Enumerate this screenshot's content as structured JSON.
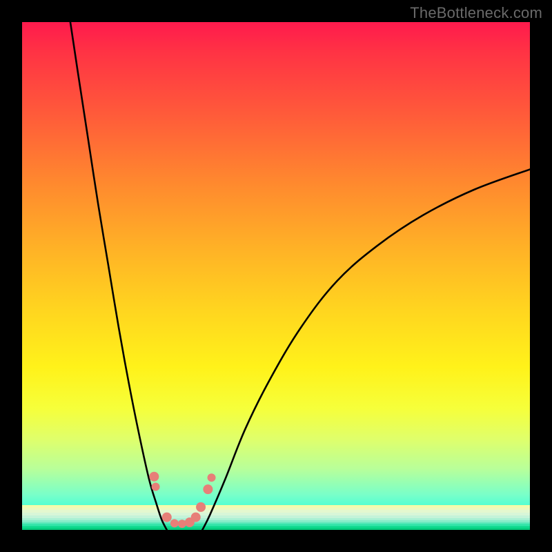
{
  "watermark": "TheBottleneck.com",
  "chart_data": {
    "type": "line",
    "title": "",
    "xlabel": "",
    "ylabel": "",
    "xlim": [
      0,
      100
    ],
    "ylim": [
      0,
      100
    ],
    "series": [
      {
        "name": "left-branch",
        "x": [
          9.5,
          11,
          13,
          15,
          17,
          19,
          21,
          23,
          25,
          26.5,
          27.5,
          28.5
        ],
        "y": [
          100,
          90,
          77,
          64,
          52,
          40,
          29,
          19,
          10,
          5,
          2,
          0
        ]
      },
      {
        "name": "right-branch",
        "x": [
          35.5,
          37,
          40,
          44,
          49,
          55,
          62,
          70,
          79,
          89,
          100
        ],
        "y": [
          0,
          3,
          10,
          20,
          30,
          40,
          49,
          56,
          62,
          67,
          71
        ]
      }
    ],
    "markers": {
      "name": "data-points",
      "color": "#e77f78",
      "points": [
        {
          "x": 26.0,
          "y": 10.5,
          "r": 7
        },
        {
          "x": 26.3,
          "y": 8.5,
          "r": 6
        },
        {
          "x": 28.5,
          "y": 2.5,
          "r": 7
        },
        {
          "x": 30.0,
          "y": 1.3,
          "r": 6
        },
        {
          "x": 31.5,
          "y": 1.2,
          "r": 6
        },
        {
          "x": 33.0,
          "y": 1.5,
          "r": 7
        },
        {
          "x": 34.2,
          "y": 2.5,
          "r": 7
        },
        {
          "x": 35.2,
          "y": 4.5,
          "r": 7
        },
        {
          "x": 36.6,
          "y": 8.0,
          "r": 7
        },
        {
          "x": 37.3,
          "y": 10.3,
          "r": 6
        }
      ]
    },
    "gradient_stops": [
      {
        "pos": 0,
        "color": "#ff1a4d"
      },
      {
        "pos": 6,
        "color": "#ff3344"
      },
      {
        "pos": 18,
        "color": "#ff5a3a"
      },
      {
        "pos": 32,
        "color": "#ff8a2e"
      },
      {
        "pos": 45,
        "color": "#ffb326"
      },
      {
        "pos": 57,
        "color": "#ffd61f"
      },
      {
        "pos": 68,
        "color": "#fff21a"
      },
      {
        "pos": 76,
        "color": "#f6ff3a"
      },
      {
        "pos": 82,
        "color": "#e0ff6a"
      },
      {
        "pos": 88,
        "color": "#b8ff9a"
      },
      {
        "pos": 93,
        "color": "#7affc8"
      },
      {
        "pos": 97,
        "color": "#34ffdc"
      },
      {
        "pos": 100,
        "color": "#10ffb0"
      }
    ],
    "bands": [
      {
        "bottom_pct": 21.5,
        "height_pct": 0.9,
        "color": "#f7fca0"
      },
      {
        "bottom_pct": 20.0,
        "height_pct": 1.5,
        "color": "#f2fbb0"
      },
      {
        "bottom_pct": 18.0,
        "height_pct": 2.0,
        "color": "#ecf9c0"
      },
      {
        "bottom_pct": 15.5,
        "height_pct": 2.5,
        "color": "#e4f8cf"
      },
      {
        "bottom_pct": 13.0,
        "height_pct": 2.5,
        "color": "#d8f6d8"
      },
      {
        "bottom_pct": 10.5,
        "height_pct": 2.5,
        "color": "#c4f3d9"
      },
      {
        "bottom_pct": 8.5,
        "height_pct": 2.0,
        "color": "#a9f0d4"
      },
      {
        "bottom_pct": 6.8,
        "height_pct": 1.7,
        "color": "#85edc9"
      },
      {
        "bottom_pct": 5.3,
        "height_pct": 1.5,
        "color": "#5de9bb"
      },
      {
        "bottom_pct": 4.0,
        "height_pct": 1.3,
        "color": "#36e5aa"
      },
      {
        "bottom_pct": 2.9,
        "height_pct": 1.1,
        "color": "#1be09a"
      },
      {
        "bottom_pct": 1.9,
        "height_pct": 1.0,
        "color": "#0fd98e"
      },
      {
        "bottom_pct": 1.0,
        "height_pct": 0.9,
        "color": "#09d184"
      },
      {
        "bottom_pct": 0.0,
        "height_pct": 1.0,
        "color": "#04c97a"
      }
    ]
  }
}
